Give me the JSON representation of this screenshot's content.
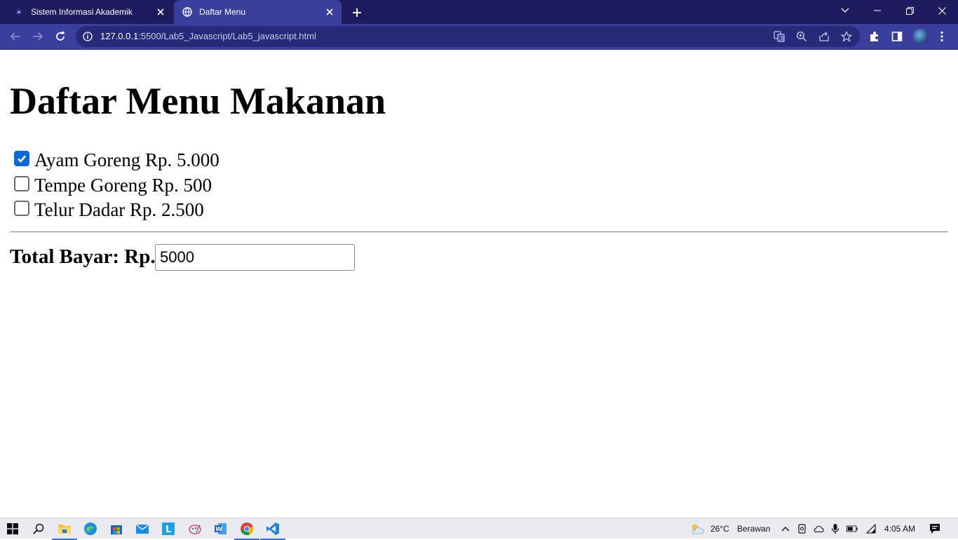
{
  "browser": {
    "tabs": [
      {
        "title": "Sistem Informasi Akademik",
        "active": false
      },
      {
        "title": "Daftar Menu",
        "active": true
      }
    ],
    "address": {
      "host": "127.0.0.1",
      "path": ":5500/Lab5_Javascript/Lab5_javascript.html"
    },
    "colors": {
      "tabbar": "#1e1b5e",
      "toolbar": "#3a3f9e"
    }
  },
  "page": {
    "heading": "Daftar Menu Makanan",
    "menu_items": [
      {
        "label": "Ayam Goreng Rp. 5.000",
        "checked": true
      },
      {
        "label": "Tempe Goreng Rp. 500",
        "checked": false
      },
      {
        "label": "Telur Dadar Rp. 2.500",
        "checked": false
      }
    ],
    "total_label": "Total Bayar: Rp.",
    "total_value": "5000",
    "checkbox_color": "#0b67d8"
  },
  "taskbar": {
    "pinned": [
      "start-icon",
      "search-icon",
      "file-explorer-icon",
      "edge-icon",
      "store-icon",
      "mail-icon",
      "lexicon-l-icon",
      "paint-icon",
      "word-icon",
      "chrome-icon",
      "vscode-icon"
    ],
    "active": [
      "chrome-icon",
      "vscode-icon"
    ],
    "weather": {
      "temperature": "26°C",
      "condition": "Berawan"
    },
    "clock": "4:05 AM"
  }
}
